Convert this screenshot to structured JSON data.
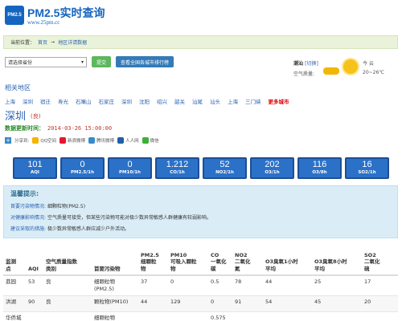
{
  "header": {
    "logo_text": "PM2.5",
    "title": "PM2.5实时查询",
    "url": "www.25pm.cc"
  },
  "breadcrumb": {
    "label": "当前位置：",
    "home": "首页",
    "sep1": "→",
    "current": "地区详请数据"
  },
  "search": {
    "province_placeholder": "请选择省份",
    "query_label": "提交",
    "rank_label": "查看全国各城市排行榜"
  },
  "weather": {
    "city": "潮汕",
    "city_suffix": "[切换]",
    "air_label": "空气质量:",
    "condition": "今 云",
    "temp": "20~26℃"
  },
  "related": {
    "title": "相关地区",
    "cities": [
      "上海",
      "深圳",
      "宿迁",
      "寿光",
      "石嘴山",
      "石家庄",
      "深圳",
      "沈阳",
      "绍兴",
      "韶关",
      "汕尾",
      "汕头",
      "上海",
      "三门峡"
    ],
    "more": "更多城市"
  },
  "city": {
    "name": "深圳",
    "grade": "(良)"
  },
  "update": {
    "label": "数据更新时间：",
    "time": "2014-03-26 15:00:00"
  },
  "share": {
    "label": "分享到:",
    "items": [
      {
        "name": "QQ空间",
        "color": "#f5b400"
      },
      {
        "name": "新浪微博",
        "color": "#e6162d"
      },
      {
        "name": "腾讯微博",
        "color": "#3a8ac9"
      },
      {
        "name": "人人网",
        "color": "#1f5fa8"
      },
      {
        "name": "微信",
        "color": "#3cb034"
      }
    ]
  },
  "metrics": [
    {
      "value": "101",
      "label": "AQI"
    },
    {
      "value": "0",
      "label": "PM2.5/1h"
    },
    {
      "value": "0",
      "label": "PM10/1h"
    },
    {
      "value": "1.212",
      "label": "CO/1h"
    },
    {
      "value": "52",
      "label": "NO2/1h"
    },
    {
      "value": "202",
      "label": "O3/1h"
    },
    {
      "value": "116",
      "label": "O3/8h"
    },
    {
      "value": "16",
      "label": "SO2/1h"
    }
  ],
  "tips": {
    "title": "温馨提示:",
    "rows": [
      {
        "key": "首要污染物情况:",
        "value": "细颗粒物(PM2.5)"
      },
      {
        "key": "对健康影响情况:",
        "value": "空气质量可接受，但某些污染物可能对极少数异常敏感人群健康有较弱影响。"
      },
      {
        "key": "建议采取的措施:",
        "value": "极少数异常敏感人群应减少户外活动。"
      }
    ]
  },
  "table": {
    "headers": [
      "监测\n点",
      "AQI",
      "空气质量指数\n类别",
      "首要污染物",
      "PM2.5\n细颗粒\n物",
      "PM10\n可吸入颗粒\n物",
      "CO\n一氧化\n碳",
      "NO2\n二氧化\n氮",
      "O3臭氧1小时\n平均",
      "O3臭氧8小时\n平均",
      "SO2\n二氧化\n硫"
    ],
    "rows": [
      [
        "荔园",
        "53",
        "良",
        "细颗粒物\n(PM2.5)",
        "37",
        "0",
        "0.5",
        "78",
        "44",
        "25",
        "17"
      ],
      [
        "洪湖",
        "90",
        "良",
        "颗粒物(PM10)",
        "44",
        "129",
        "0",
        "91",
        "54",
        "45",
        "20"
      ],
      [
        "华侨城",
        "",
        "",
        "细颗粒物",
        "",
        "",
        "0.575",
        "",
        "",
        "",
        ""
      ]
    ]
  }
}
